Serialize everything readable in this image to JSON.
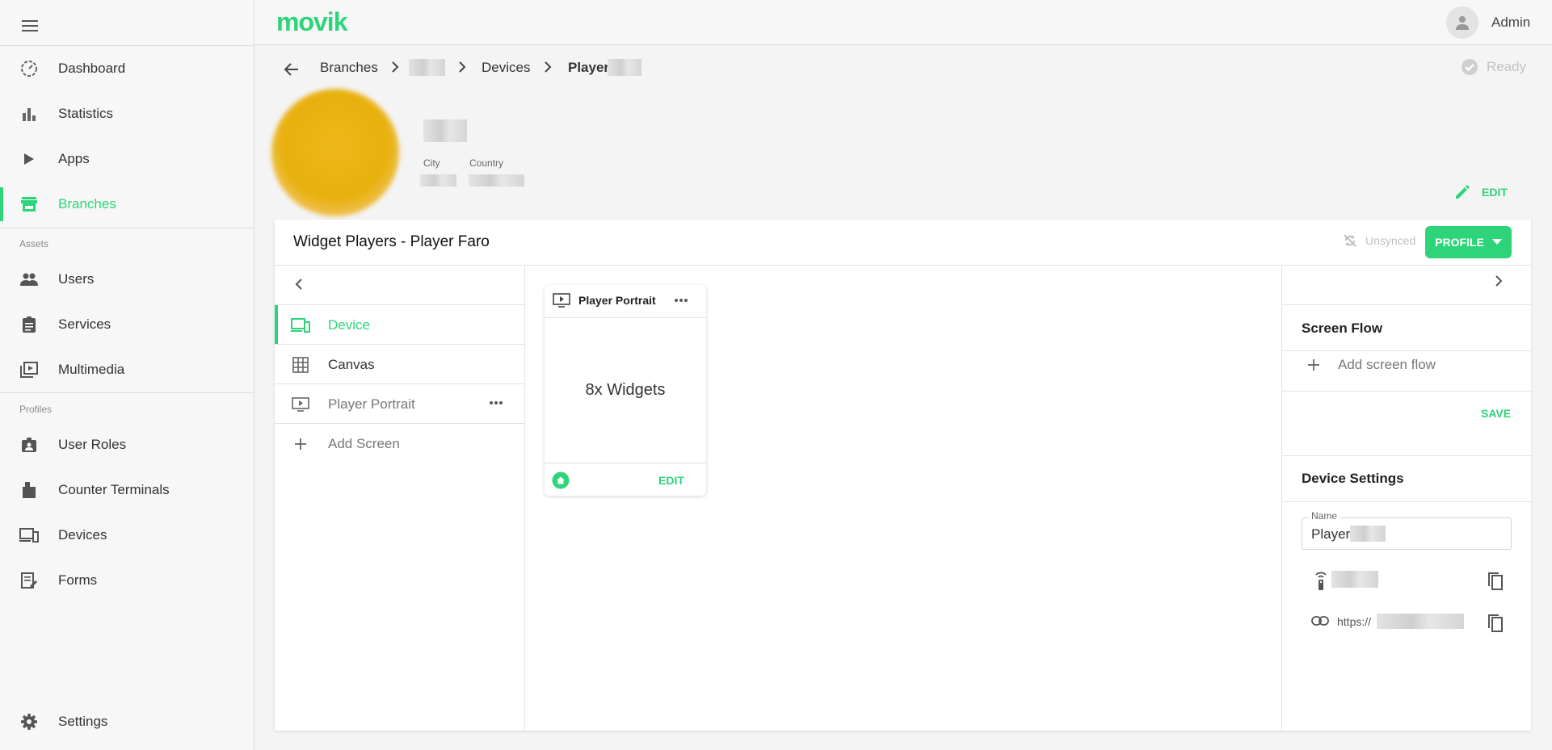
{
  "app": {
    "logo": "movik",
    "user": "Admin"
  },
  "sidebar": {
    "items": [
      {
        "label": "Dashboard"
      },
      {
        "label": "Statistics"
      },
      {
        "label": "Apps"
      },
      {
        "label": "Branches",
        "active": true
      },
      {
        "label": "Users"
      },
      {
        "label": "Services"
      },
      {
        "label": "Multimedia"
      },
      {
        "label": "User Roles"
      },
      {
        "label": "Counter Terminals"
      },
      {
        "label": "Devices"
      },
      {
        "label": "Forms"
      },
      {
        "label": "Settings"
      }
    ],
    "sections": {
      "assets": "Assets",
      "profiles": "Profiles"
    }
  },
  "breadcrumb": {
    "branches": "Branches",
    "devices": "Devices",
    "player": "Player"
  },
  "status": {
    "ready": "Ready"
  },
  "branch": {
    "city_label": "City",
    "country_label": "Country",
    "edit_label": "EDIT"
  },
  "card": {
    "title": "Widget Players -  Player Faro",
    "unsynced": "Unsynced",
    "profile_label": "PROFILE"
  },
  "left_panel": {
    "items": [
      {
        "label": "Device",
        "active": true
      },
      {
        "label": "Canvas"
      },
      {
        "label": "Player Portrait"
      },
      {
        "label": "Add Screen"
      }
    ]
  },
  "screen_card": {
    "title": "Player Portrait",
    "widgets": "8x Widgets",
    "edit_label": "EDIT"
  },
  "right_panel": {
    "screen_flow_title": "Screen Flow",
    "add_screen_flow": "Add screen flow",
    "save_label": "SAVE",
    "device_settings_title": "Device Settings",
    "name_label": "Name",
    "name_value": "Player",
    "url_prefix": "https://"
  },
  "colors": {
    "accent": "#2ed47a",
    "brand_image": "#e8b00c"
  }
}
